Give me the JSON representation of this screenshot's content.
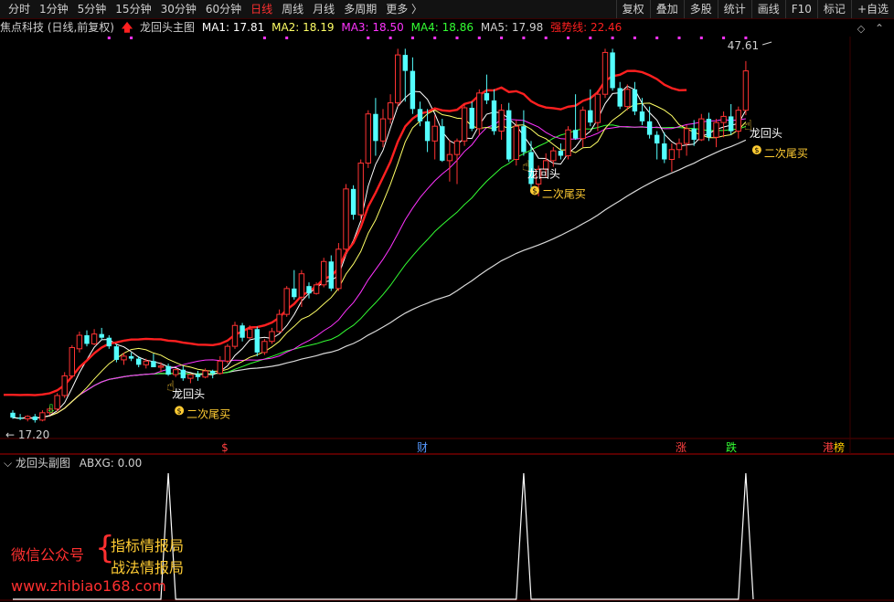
{
  "toolbar": {
    "periods": [
      {
        "label": "分时",
        "active": false
      },
      {
        "label": "1分钟",
        "active": false
      },
      {
        "label": "5分钟",
        "active": false
      },
      {
        "label": "15分钟",
        "active": false
      },
      {
        "label": "30分钟",
        "active": false
      },
      {
        "label": "60分钟",
        "active": false
      },
      {
        "label": "日线",
        "active": true
      },
      {
        "label": "周线",
        "active": false
      },
      {
        "label": "月线",
        "active": false
      },
      {
        "label": "多周期",
        "active": false
      },
      {
        "label": "更多 〉",
        "active": false
      }
    ],
    "buttons": [
      "复权",
      "叠加",
      "多股",
      "统计",
      "画线",
      "F10",
      "标记",
      "+自选"
    ]
  },
  "info": {
    "stock": "焦点科技 (日线,前复权)",
    "indicator_name": "龙回头主图",
    "ma1": "MA1: 17.81",
    "ma2": "MA2: 18.19",
    "ma3": "MA3: 18.50",
    "ma4": "MA4: 18.86",
    "ma5": "MA5: 17.98",
    "strong": "强势线: 22.46"
  },
  "colors": {
    "up": "#ff3333",
    "down": "#54ffff",
    "ma1": "#ffffff",
    "ma2": "#ffff66",
    "ma3": "#ff33ff",
    "ma4": "#33ff33",
    "ma5": "#d8d8d8",
    "strong": "#ff2020"
  },
  "price_labels": {
    "high": "47.61",
    "low": "← 17.20"
  },
  "annotations": {
    "signal": "龙回头",
    "buy": "二次尾买"
  },
  "event_markers": [
    {
      "text": "$",
      "color": "#ff4040"
    },
    {
      "text": "财",
      "color": "#5599ff"
    },
    {
      "text": "涨",
      "color": "#ff4040"
    },
    {
      "text": "跌",
      "color": "#33ff33"
    },
    {
      "text": "港",
      "color": "#ff4040"
    },
    {
      "text": "榜",
      "color": "#ffcc00"
    }
  ],
  "sub": {
    "name": "龙回头副图",
    "value": "ABXG: 0.00"
  },
  "watermark": {
    "account_label": "微信公众号",
    "line1": "指标情报局",
    "line2": "战法情报局",
    "url": "www.zhibiao168.com"
  },
  "candles": [
    [
      18.0,
      18.2,
      17.5,
      17.6
    ],
    [
      17.6,
      17.9,
      17.4,
      17.5
    ],
    [
      17.5,
      17.8,
      17.3,
      17.7
    ],
    [
      17.7,
      17.9,
      17.2,
      17.4
    ],
    [
      17.4,
      18.2,
      17.3,
      18.0
    ],
    [
      18.0,
      18.5,
      17.8,
      18.3
    ],
    [
      18.3,
      19.6,
      18.1,
      19.4
    ],
    [
      19.4,
      21.3,
      19.2,
      21.0
    ],
    [
      21.0,
      23.5,
      20.8,
      23.3
    ],
    [
      23.2,
      24.6,
      22.9,
      24.3
    ],
    [
      24.3,
      24.7,
      23.4,
      23.6
    ],
    [
      23.6,
      24.8,
      23.5,
      24.4
    ],
    [
      24.4,
      24.9,
      23.9,
      24.1
    ],
    [
      24.1,
      24.3,
      23.2,
      23.4
    ],
    [
      23.4,
      23.6,
      22.1,
      22.3
    ],
    [
      22.3,
      22.9,
      21.9,
      22.6
    ],
    [
      22.6,
      22.9,
      22.2,
      22.4
    ],
    [
      22.4,
      22.6,
      21.7,
      21.9
    ],
    [
      21.9,
      22.4,
      21.6,
      22.2
    ],
    [
      22.2,
      22.8,
      21.8,
      21.7
    ],
    [
      21.7,
      22.1,
      21.3,
      21.8
    ],
    [
      21.8,
      22.0,
      21.0,
      21.1
    ],
    [
      21.1,
      21.6,
      20.9,
      21.5
    ],
    [
      21.5,
      21.8,
      20.6,
      20.8
    ],
    [
      20.8,
      21.2,
      20.4,
      21.1
    ],
    [
      21.1,
      21.4,
      20.6,
      20.9
    ],
    [
      20.9,
      21.6,
      20.8,
      21.4
    ],
    [
      21.4,
      21.5,
      20.8,
      21.2
    ],
    [
      21.2,
      22.6,
      21.1,
      22.2
    ],
    [
      22.2,
      23.6,
      22.0,
      23.4
    ],
    [
      23.4,
      25.4,
      23.2,
      25.1
    ],
    [
      25.1,
      25.3,
      23.8,
      24.1
    ],
    [
      24.1,
      25.1,
      24.0,
      24.8
    ],
    [
      24.8,
      25.0,
      22.6,
      22.9
    ],
    [
      22.9,
      24.0,
      22.7,
      23.8
    ],
    [
      23.8,
      24.9,
      23.6,
      24.6
    ],
    [
      24.6,
      26.4,
      24.5,
      26.0
    ],
    [
      26.0,
      28.3,
      25.8,
      28.1
    ],
    [
      28.1,
      29.6,
      27.2,
      27.4
    ],
    [
      27.4,
      29.6,
      26.6,
      29.3
    ],
    [
      28.3,
      28.6,
      27.3,
      27.7
    ],
    [
      27.7,
      28.6,
      27.6,
      28.4
    ],
    [
      28.4,
      30.6,
      28.2,
      30.3
    ],
    [
      30.3,
      30.8,
      27.9,
      28.1
    ],
    [
      28.1,
      31.8,
      27.9,
      31.3
    ],
    [
      31.3,
      36.6,
      31.1,
      36.2
    ],
    [
      36.2,
      36.5,
      33.7,
      34.1
    ],
    [
      34.1,
      38.6,
      33.6,
      38.3
    ],
    [
      38.3,
      42.6,
      37.9,
      42.3
    ],
    [
      42.3,
      43.6,
      38.9,
      40.1
    ],
    [
      40.1,
      42.7,
      39.6,
      41.9
    ],
    [
      41.9,
      43.9,
      41.5,
      43.2
    ],
    [
      43.2,
      47.6,
      42.9,
      47.1
    ],
    [
      47.1,
      47.6,
      43.3,
      45.8
    ],
    [
      45.8,
      46.9,
      42.3,
      42.7
    ],
    [
      42.7,
      43.3,
      41.3,
      41.7
    ],
    [
      41.7,
      42.7,
      39.2,
      40.1
    ],
    [
      40.1,
      42.2,
      38.6,
      41.3
    ],
    [
      41.3,
      41.9,
      38.4,
      38.5
    ],
    [
      38.5,
      40.2,
      36.8,
      39.0
    ],
    [
      39.0,
      40.3,
      36.6,
      40.1
    ],
    [
      40.1,
      43.1,
      39.7,
      42.8
    ],
    [
      42.8,
      43.3,
      40.9,
      41.1
    ],
    [
      41.1,
      44.3,
      40.6,
      44.0
    ],
    [
      44.0,
      45.5,
      43.1,
      43.4
    ],
    [
      43.4,
      44.3,
      40.6,
      40.9
    ],
    [
      40.9,
      43.1,
      40.2,
      42.6
    ],
    [
      42.6,
      43.2,
      38.4,
      38.6
    ],
    [
      38.6,
      41.8,
      38.1,
      41.3
    ],
    [
      41.3,
      42.6,
      38.9,
      39.2
    ],
    [
      39.2,
      40.1,
      36.0,
      36.6
    ],
    [
      36.6,
      38.1,
      35.6,
      37.8
    ],
    [
      37.8,
      39.1,
      37.1,
      38.5
    ],
    [
      38.5,
      39.6,
      38.0,
      39.3
    ],
    [
      39.3,
      39.9,
      38.6,
      38.9
    ],
    [
      38.9,
      41.3,
      38.6,
      41.0
    ],
    [
      41.0,
      43.9,
      40.2,
      40.3
    ],
    [
      40.3,
      42.9,
      39.6,
      42.6
    ],
    [
      42.6,
      44.3,
      41.3,
      41.6
    ],
    [
      41.6,
      44.2,
      40.9,
      43.9
    ],
    [
      43.9,
      47.6,
      43.6,
      47.3
    ],
    [
      47.3,
      47.6,
      44.2,
      44.4
    ],
    [
      44.4,
      44.9,
      42.7,
      42.9
    ],
    [
      42.9,
      44.7,
      42.6,
      44.3
    ],
    [
      44.3,
      44.9,
      42.2,
      42.5
    ],
    [
      42.5,
      43.6,
      41.4,
      41.7
    ],
    [
      41.7,
      42.9,
      40.3,
      40.6
    ],
    [
      40.6,
      40.9,
      38.6,
      39.9
    ],
    [
      39.9,
      40.8,
      38.3,
      38.6
    ],
    [
      38.6,
      39.9,
      37.6,
      39.4
    ],
    [
      39.4,
      40.3,
      38.7,
      39.9
    ],
    [
      39.9,
      41.4,
      38.9,
      41.1
    ],
    [
      41.1,
      41.8,
      39.7,
      40.2
    ],
    [
      40.2,
      42.3,
      40.1,
      41.9
    ],
    [
      41.9,
      42.4,
      40.1,
      40.4
    ],
    [
      40.4,
      41.9,
      39.6,
      41.6
    ],
    [
      41.6,
      42.5,
      40.4,
      42.1
    ],
    [
      42.1,
      43.1,
      40.6,
      40.9
    ],
    [
      40.9,
      42.9,
      40.3,
      42.6
    ],
    [
      42.6,
      46.6,
      42.2,
      45.8
    ]
  ],
  "signal_bars": [
    21,
    69,
    99
  ]
}
